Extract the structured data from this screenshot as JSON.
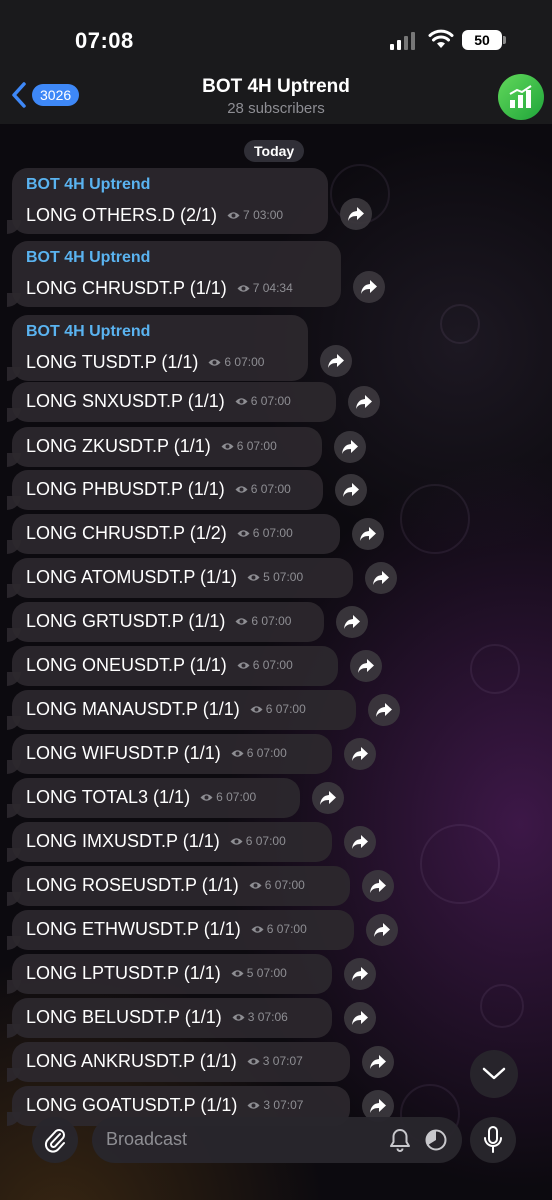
{
  "status_bar": {
    "time": "07:08",
    "battery": "50"
  },
  "header": {
    "back_count": "3026",
    "title": "BOT 4H Uptrend",
    "subtitle": "28 subscribers"
  },
  "date_separator": "Today",
  "messages": [
    {
      "sender": "BOT 4H Uptrend",
      "text": "LONG OTHERS.D (2/1)",
      "views": "7",
      "time": "03:00"
    },
    {
      "sender": "BOT 4H Uptrend",
      "text": "LONG CHRUSDT.P (1/1)",
      "views": "7",
      "time": "04:34"
    },
    {
      "sender": "BOT 4H Uptrend",
      "text": "LONG TUSDT.P (1/1)",
      "views": "6",
      "time": "07:00"
    },
    {
      "text": "LONG SNXUSDT.P (1/1)",
      "views": "6",
      "time": "07:00"
    },
    {
      "text": "LONG ZKUSDT.P (1/1)",
      "views": "6",
      "time": "07:00"
    },
    {
      "text": "LONG PHBUSDT.P (1/1)",
      "views": "6",
      "time": "07:00"
    },
    {
      "text": "LONG CHRUSDT.P (1/2)",
      "views": "6",
      "time": "07:00"
    },
    {
      "text": "LONG ATOMUSDT.P (1/1)",
      "views": "5",
      "time": "07:00"
    },
    {
      "text": "LONG GRTUSDT.P (1/1)",
      "views": "6",
      "time": "07:00"
    },
    {
      "text": "LONG ONEUSDT.P (1/1)",
      "views": "6",
      "time": "07:00"
    },
    {
      "text": "LONG MANAUSDT.P (1/1)",
      "views": "6",
      "time": "07:00"
    },
    {
      "text": "LONG WIFUSDT.P (1/1)",
      "views": "6",
      "time": "07:00"
    },
    {
      "text": "LONG TOTAL3 (1/1)",
      "views": "6",
      "time": "07:00"
    },
    {
      "text": "LONG IMXUSDT.P (1/1)",
      "views": "6",
      "time": "07:00"
    },
    {
      "text": "LONG ROSEUSDT.P (1/1)",
      "views": "6",
      "time": "07:00"
    },
    {
      "text": "LONG ETHWUSDT.P (1/1)",
      "views": "6",
      "time": "07:00"
    },
    {
      "text": "LONG LPTUSDT.P (1/1)",
      "views": "5",
      "time": "07:00"
    },
    {
      "text": "LONG BELUSDT.P (1/1)",
      "views": "3",
      "time": "07:06"
    },
    {
      "text": "LONG ANKRUSDT.P (1/1)",
      "views": "3",
      "time": "07:07"
    },
    {
      "text": "LONG GOATUSDT.P (1/1)",
      "views": "3",
      "time": "07:07"
    }
  ],
  "input": {
    "placeholder": "Broadcast"
  },
  "colors": {
    "accent": "#3e88f7",
    "sender": "#5ab3f0",
    "avatar": "#3dbf4a"
  }
}
